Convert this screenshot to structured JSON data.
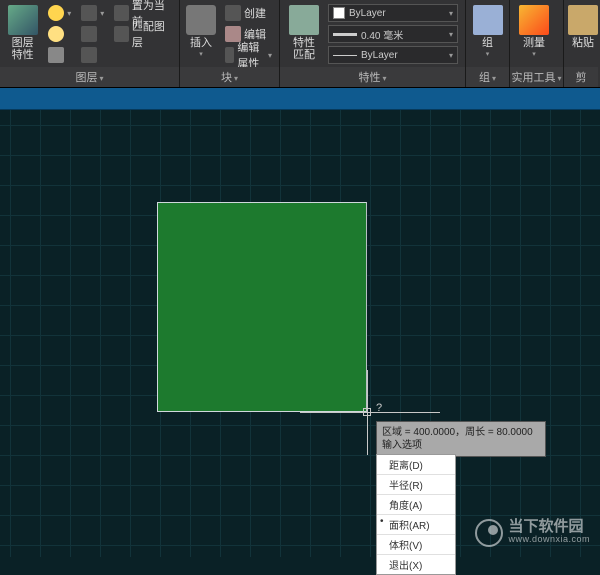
{
  "ribbon": {
    "layer_panel": {
      "title": "图层",
      "layer_prop": "图层\n特性",
      "set_current": "置为当前",
      "match_layer": "匹配图层"
    },
    "block_panel": {
      "title": "块",
      "insert": "插入",
      "create": "创建",
      "edit": "编辑",
      "edit_attr": "编辑属性"
    },
    "properties_panel": {
      "title": "特性",
      "match": "特性\n匹配",
      "color": "ByLayer",
      "lineweight": "0.40 毫米",
      "linetype": "ByLayer"
    },
    "group_panel": {
      "title": "组",
      "group": "组"
    },
    "utilities_panel": {
      "title": "实用工具",
      "measure": "测量"
    },
    "clipboard_panel": {
      "title": "剪",
      "paste": "粘贴"
    }
  },
  "tooltip": {
    "line1": "区域 = 400.0000，周长 = 80.0000",
    "line2": "输入选项"
  },
  "prompt_char": "?",
  "menu": {
    "items": [
      {
        "label": "距离(D)",
        "sel": false
      },
      {
        "label": "半径(R)",
        "sel": false
      },
      {
        "label": "角度(A)",
        "sel": false
      },
      {
        "label": "面积(AR)",
        "sel": true
      },
      {
        "label": "体积(V)",
        "sel": false
      },
      {
        "label": "退出(X)",
        "sel": false
      }
    ]
  },
  "watermark": {
    "name": "当下软件园",
    "url": "www.downxia.com"
  }
}
